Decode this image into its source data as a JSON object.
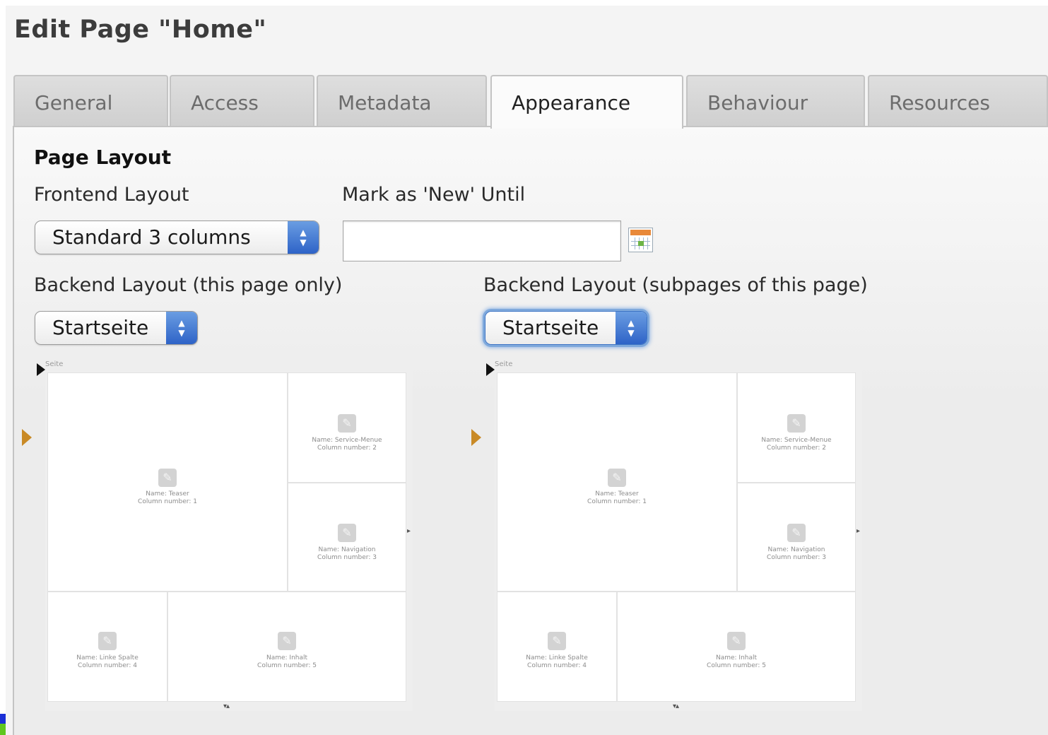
{
  "page": {
    "title": "Edit Page \"Home\""
  },
  "tabs": [
    {
      "label": "General",
      "active": false
    },
    {
      "label": "Access",
      "active": false
    },
    {
      "label": "Metadata",
      "active": false
    },
    {
      "label": "Appearance",
      "active": true
    },
    {
      "label": "Behaviour",
      "active": false
    },
    {
      "label": "Resources",
      "active": false
    }
  ],
  "page_layout": {
    "heading": "Page Layout",
    "frontend_layout": {
      "label": "Frontend Layout",
      "value": "Standard 3 columns"
    },
    "new_until": {
      "label": "Mark as 'New' Until",
      "value": "",
      "icon": "calendar-icon"
    },
    "backend_layout_page": {
      "label": "Backend Layout (this page only)",
      "value": "Startseite"
    },
    "backend_layout_subpages": {
      "label": "Backend Layout (subpages of this page)",
      "value": "Startseite"
    }
  },
  "layout_preview": {
    "title": "Seite",
    "columns": [
      {
        "name": "Name: Teaser",
        "number": "Column number: 1"
      },
      {
        "name": "Name: Service-Menue",
        "number": "Column number: 2"
      },
      {
        "name": "Name: Navigation",
        "number": "Column number: 3"
      },
      {
        "name": "Name: Linke Spalte",
        "number": "Column number: 4"
      },
      {
        "name": "Name: Inhalt",
        "number": "Column number: 5"
      }
    ]
  },
  "colors": {
    "accent_orange": "#c98a26",
    "select_blue": "#2e63c7",
    "focus_ring": "#7fa9dc"
  }
}
